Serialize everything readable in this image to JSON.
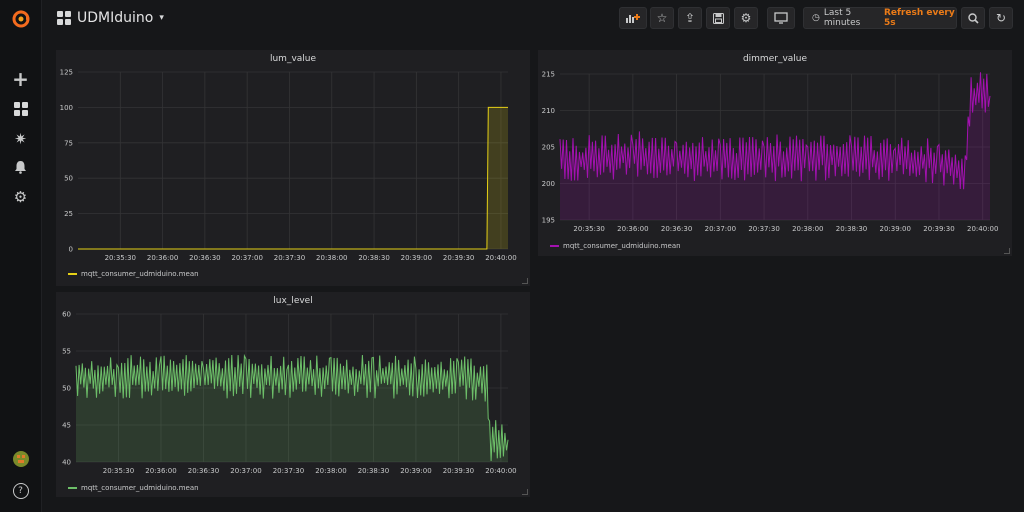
{
  "sidebar": {
    "logo": "grafana-logo-icon",
    "items": [
      {
        "name": "add-icon",
        "glyph": "+"
      },
      {
        "name": "dashboards-icon",
        "glyph": "▦"
      },
      {
        "name": "explore-icon",
        "glyph": "✷"
      },
      {
        "name": "alerting-bell-icon",
        "glyph": "🔔"
      },
      {
        "name": "configuration-gear-icon",
        "glyph": "⚙"
      }
    ],
    "help_glyph": "?"
  },
  "header": {
    "dashboard_title": "UDMIduino",
    "caret": "▾",
    "buttons": [
      {
        "name": "add-panel-icon",
        "glyph": "📊"
      },
      {
        "name": "star-icon",
        "glyph": "☆"
      },
      {
        "name": "share-icon",
        "glyph": "⇪"
      },
      {
        "name": "save-icon",
        "glyph": "💾"
      },
      {
        "name": "settings-gear-icon",
        "glyph": "⚙"
      },
      {
        "name": "tv-mode-icon",
        "glyph": "🖵"
      }
    ],
    "time_range": "Last 5 minutes",
    "refresh": "Refresh every 5s",
    "clock_glyph": "◷",
    "zoom_glyph": "🔍",
    "refresh_glyph": "↻"
  },
  "colors": {
    "lum": "#e5d016",
    "dimmer": "#a311b0",
    "lux": "#6dbf69",
    "accent": "#eb7b18"
  },
  "panels": [
    {
      "id": "lum",
      "title": "lum_value",
      "legend": "mqtt_consumer_udmiduino.mean",
      "chart_data": {
        "type": "area",
        "ylim": [
          0,
          125
        ],
        "yticks": [
          0,
          25,
          50,
          75,
          100,
          125
        ],
        "xticks": [
          "20:35:30",
          "20:36:00",
          "20:36:30",
          "20:37:00",
          "20:37:30",
          "20:38:00",
          "20:38:30",
          "20:39:00",
          "20:39:30",
          "20:40:00"
        ],
        "series": [
          {
            "name": "mqtt_consumer_udmiduino.mean",
            "x": [
              "20:35:00",
              "20:35:30",
              "20:36:00",
              "20:36:30",
              "20:37:00",
              "20:37:30",
              "20:38:00",
              "20:38:30",
              "20:39:00",
              "20:39:30",
              "20:39:50",
              "20:39:51",
              "20:40:05"
            ],
            "values": [
              0,
              0,
              0,
              0,
              0,
              0,
              0,
              0,
              0,
              0,
              0,
              100,
              100
            ]
          }
        ]
      }
    },
    {
      "id": "dimmer",
      "title": "dimmer_value",
      "legend": "mqtt_consumer_udmiduino.mean",
      "chart_data": {
        "type": "area",
        "ylim": [
          195,
          215
        ],
        "yticks": [
          195,
          200,
          205,
          210,
          215
        ],
        "xticks": [
          "20:35:30",
          "20:36:00",
          "20:36:30",
          "20:37:00",
          "20:37:30",
          "20:38:00",
          "20:38:30",
          "20:39:00",
          "20:39:30",
          "20:40:00"
        ],
        "series": [
          {
            "name": "mqtt_consumer_udmiduino.mean",
            "x": [
              "20:35:10",
              "20:35:30",
              "20:36:00",
              "20:36:30",
              "20:37:00",
              "20:37:30",
              "20:38:00",
              "20:38:30",
              "20:39:00",
              "20:39:30",
              "20:39:48",
              "20:39:52",
              "20:40:05"
            ],
            "values": [
              203,
              203.5,
              204,
              203.5,
              203,
              203.5,
              203.5,
              203.5,
              203.5,
              203,
              202,
              212,
              212
            ]
          }
        ]
      }
    },
    {
      "id": "lux",
      "title": "lux_level",
      "legend": "mqtt_consumer_udmiduino.mean",
      "chart_data": {
        "type": "area",
        "ylim": [
          40,
          60
        ],
        "yticks": [
          40,
          45,
          50,
          55,
          60
        ],
        "xticks": [
          "20:35:30",
          "20:36:00",
          "20:36:30",
          "20:37:00",
          "20:37:30",
          "20:38:00",
          "20:38:30",
          "20:39:00",
          "20:39:30",
          "20:40:00"
        ],
        "series": [
          {
            "name": "mqtt_consumer_udmiduino.mean",
            "x": [
              "20:35:00",
              "20:35:30",
              "20:36:00",
              "20:36:30",
              "20:37:00",
              "20:37:30",
              "20:38:00",
              "20:38:30",
              "20:39:00",
              "20:39:30",
              "20:39:50",
              "20:39:52",
              "20:40:05"
            ],
            "values": [
              51.5,
              51.5,
              51.5,
              51.5,
              51.5,
              51.5,
              51.5,
              51.5,
              51.5,
              51.5,
              51,
              43,
              43
            ]
          }
        ]
      }
    }
  ]
}
